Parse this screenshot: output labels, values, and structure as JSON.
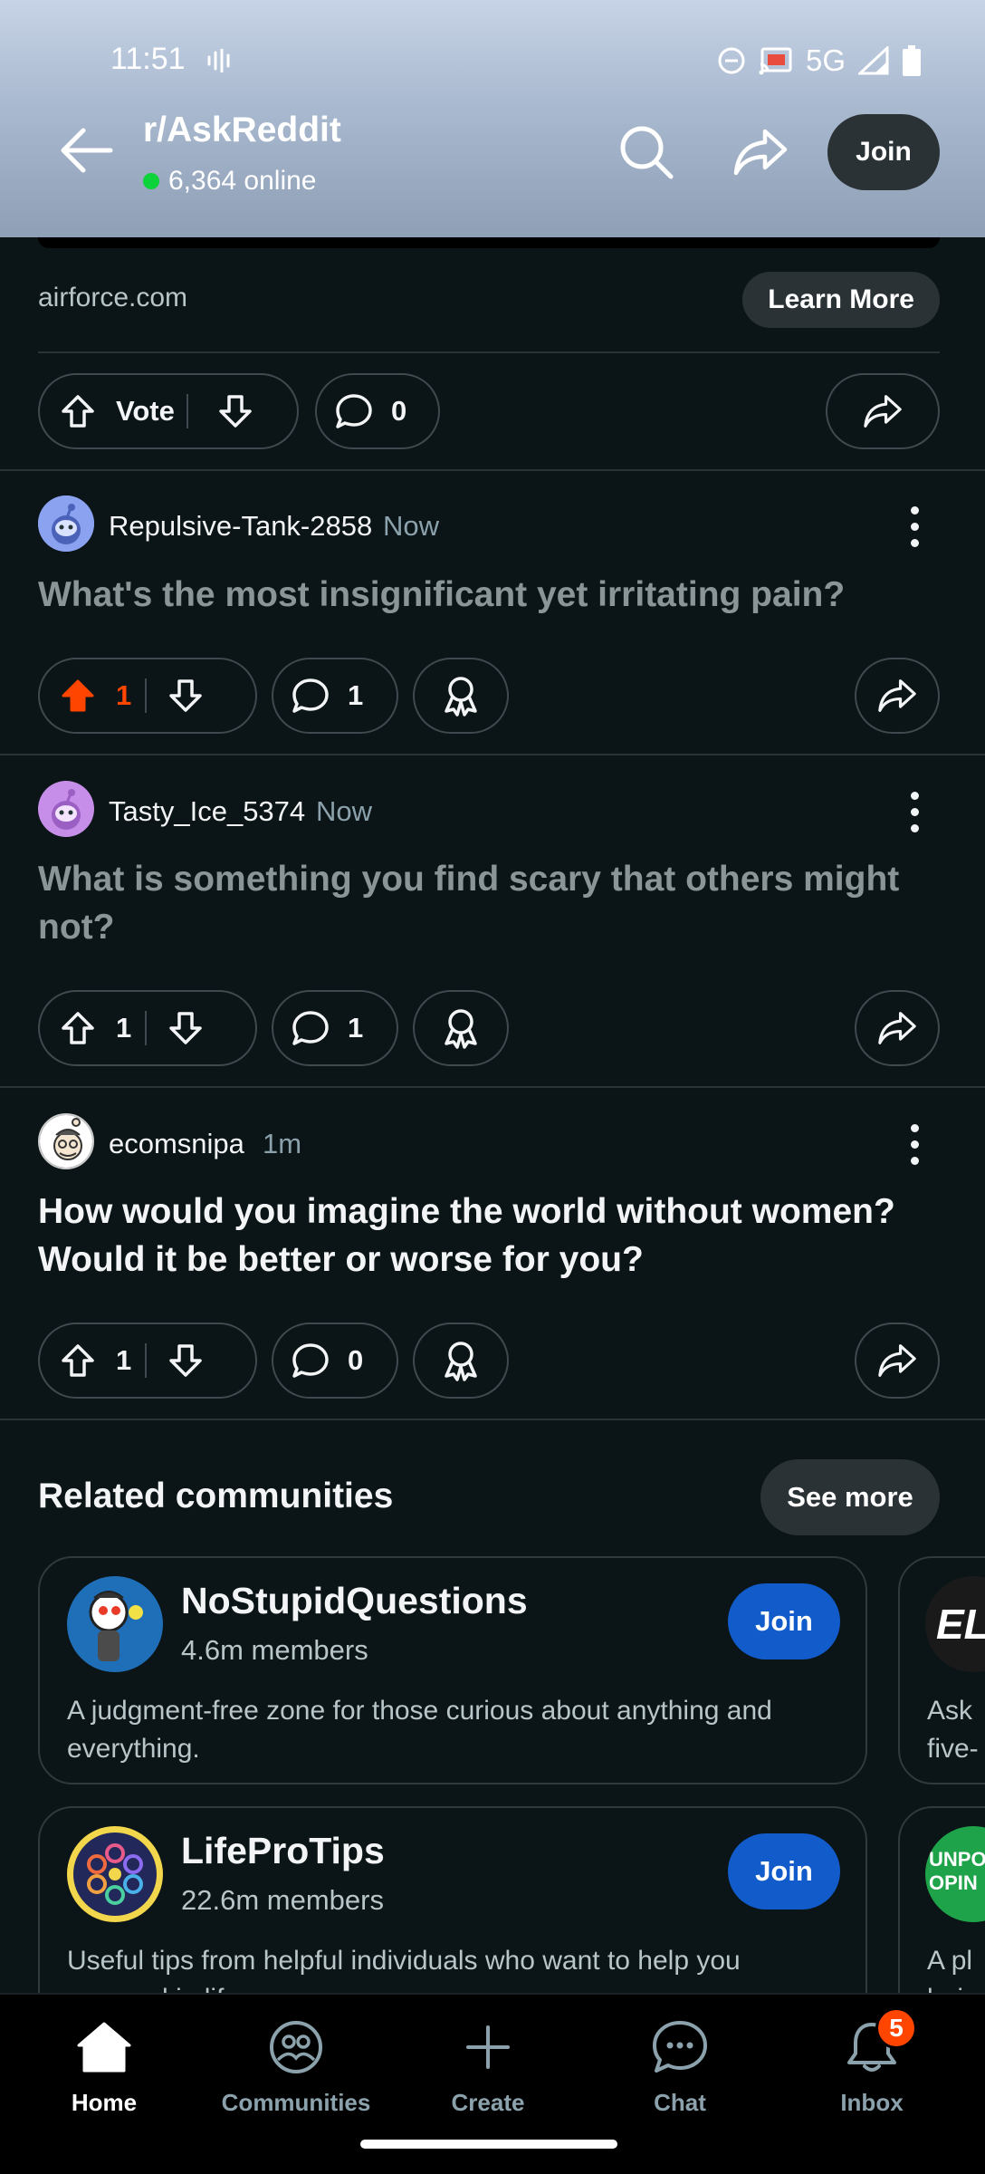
{
  "status_bar": {
    "time": "11:51",
    "network": "5G",
    "icons": [
      "voice-wave-icon",
      "do-not-disturb-icon",
      "cast-icon",
      "signal-icon",
      "battery-icon"
    ]
  },
  "header": {
    "title": "r/AskReddit",
    "online_count": "6,364 online",
    "join_label": "Join",
    "online_color": "#0dd33a"
  },
  "ad": {
    "domain": "airforce.com",
    "cta": "Learn More",
    "vote_label": "Vote",
    "comment_count": "0"
  },
  "posts": [
    {
      "username": "Repulsive-Tank-2858",
      "time": "Now",
      "title": "What's the most insignificant yet irritating pain?",
      "votes": "1",
      "upvoted": true,
      "comments": "1",
      "read": true
    },
    {
      "username": "Tasty_Ice_5374",
      "time": "Now",
      "title": "What is something you find scary that others might not?",
      "votes": "1",
      "upvoted": false,
      "comments": "1",
      "read": true
    },
    {
      "username": "ecomsnipa",
      "time": "1m",
      "title": "How would you imagine the world without women? Would it be better or worse for you?",
      "votes": "1",
      "upvoted": false,
      "comments": "0",
      "read": false
    }
  ],
  "related": {
    "title": "Related communities",
    "see_more": "See more",
    "communities": [
      {
        "name": "NoStupidQuestions",
        "members": "4.6m members",
        "join": "Join",
        "description": "A judgment-free zone for those curious about anything and everything."
      },
      {
        "name": "LifeProTips",
        "members": "22.6m members",
        "join": "Join",
        "description": "Useful tips from helpful individuals who want to help you succeed in life."
      }
    ],
    "peek": [
      {
        "avatar_text": "EL",
        "desc_line1": "Ask",
        "desc_line2": "five-"
      },
      {
        "avatar_text": "UNPOP OPIN",
        "desc_line1": "A pl",
        "desc_line2": "bein"
      }
    ]
  },
  "nav": {
    "items": [
      {
        "label": "Home",
        "icon": "home-icon",
        "active": true
      },
      {
        "label": "Communities",
        "icon": "communities-icon",
        "active": false
      },
      {
        "label": "Create",
        "icon": "plus-icon",
        "active": false
      },
      {
        "label": "Chat",
        "icon": "chat-icon",
        "active": false
      },
      {
        "label": "Inbox",
        "icon": "bell-icon",
        "active": false
      }
    ],
    "inbox_badge": "5"
  },
  "colors": {
    "background": "#0b1416",
    "upvote": "#ff4500",
    "join_blue": "#115bca",
    "pill_border": "#3e4a50"
  }
}
